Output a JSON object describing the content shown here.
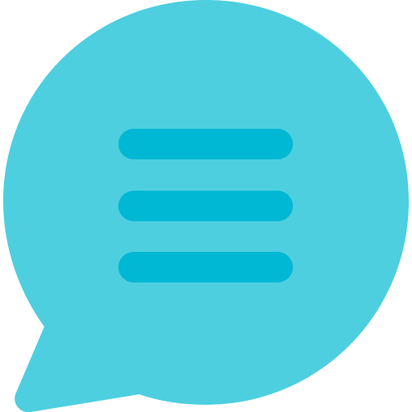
{
  "icon": {
    "name": "chat-bubble-icon",
    "lines": 3
  },
  "colors": {
    "bubble": "#4DCFE0",
    "lines": "#00B8D4",
    "background": "#FFFFFF"
  }
}
